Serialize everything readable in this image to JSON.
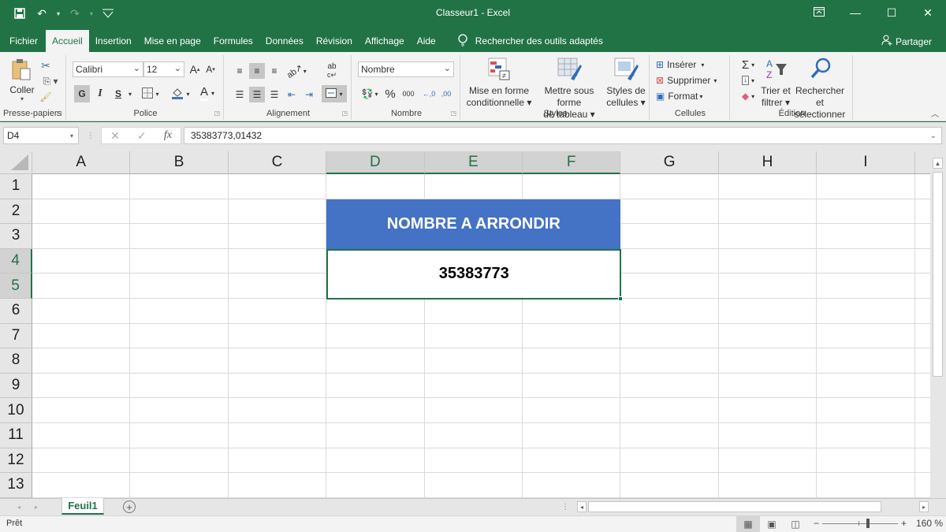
{
  "window": {
    "title": "Classeur1  -  Excel",
    "quick_access": [
      {
        "name": "save-icon",
        "glyph": "💾"
      },
      {
        "name": "undo-icon",
        "glyph": "↶"
      },
      {
        "name": "redo-icon",
        "glyph": "↷"
      },
      {
        "name": "customize-qat-icon",
        "glyph": "▽"
      }
    ],
    "controls": [
      {
        "name": "ribbon-display-options-icon",
        "glyph": "⊡"
      },
      {
        "name": "minimize-icon",
        "glyph": "—"
      },
      {
        "name": "maximize-icon",
        "glyph": "☐"
      },
      {
        "name": "close-icon",
        "glyph": "✕"
      }
    ]
  },
  "tabs": [
    {
      "label": "Fichier",
      "active": false
    },
    {
      "label": "Accueil",
      "active": true
    },
    {
      "label": "Insertion",
      "active": false
    },
    {
      "label": "Mise en page",
      "active": false
    },
    {
      "label": "Formules",
      "active": false
    },
    {
      "label": "Données",
      "active": false
    },
    {
      "label": "Révision",
      "active": false
    },
    {
      "label": "Affichage",
      "active": false
    },
    {
      "label": "Aide",
      "active": false
    }
  ],
  "tell_me": {
    "icon": "lightbulb-icon",
    "label": "Rechercher des outils adaptés"
  },
  "share": {
    "icon": "person-add-icon",
    "label": "Partager"
  },
  "ribbon": {
    "clipboard": {
      "label": "Presse-papiers",
      "paste": "Coller"
    },
    "font": {
      "label": "Police",
      "font_name": "Calibri",
      "font_size": "12",
      "bold": "G",
      "italic": "I",
      "underline": "S",
      "grow": "A",
      "shrink": "A",
      "font_color": "A"
    },
    "alignment": {
      "label": "Alignement",
      "wrap": "ab"
    },
    "number": {
      "label": "Nombre",
      "format": "Nombre",
      "percent": "%",
      "thousands": "000",
      "inc_decimal": "←,0",
      "dec_decimal": ",00"
    },
    "styles": {
      "label": "Styles",
      "conditional": [
        "Mise en forme",
        "conditionnelle ▾"
      ],
      "table": [
        "Mettre sous forme",
        "de tableau ▾"
      ],
      "cell_styles": [
        "Styles de",
        "cellules ▾"
      ]
    },
    "cells": {
      "label": "Cellules",
      "insert": "Insérer",
      "delete": "Supprimer",
      "format": "Format"
    },
    "editing": {
      "label": "Édition",
      "sort": [
        "Trier et",
        "filtrer ▾"
      ],
      "find": [
        "Rechercher et",
        "sélectionner ▾"
      ]
    }
  },
  "formula_bar": {
    "name_box": "D4",
    "fx": "fx",
    "cancel": "✕",
    "enter": "✓",
    "value": "35383773,01432"
  },
  "grid": {
    "columns": [
      "A",
      "B",
      "C",
      "D",
      "E",
      "F",
      "G",
      "H",
      "I"
    ],
    "rows": [
      "1",
      "2",
      "3",
      "4",
      "5",
      "6",
      "7",
      "8",
      "9",
      "10",
      "11",
      "12",
      "13"
    ],
    "selected_columns": [
      "D",
      "E",
      "F"
    ],
    "selected_rows": [
      "4",
      "5"
    ],
    "header_cell": {
      "range": "D2:F3",
      "text": "NOMBRE A ARRONDIR",
      "fill": "#4472c4"
    },
    "value_cell": {
      "range": "D4:F5",
      "text": "35383773"
    }
  },
  "sheet_tabs": [
    {
      "label": "Feuil1",
      "active": true
    }
  ],
  "add_sheet": "+",
  "status": {
    "text": "Prêt",
    "zoom": "160 %",
    "zoom_percent": 160
  },
  "colors": {
    "accent": "#217346",
    "header_fill": "#4472c4"
  }
}
